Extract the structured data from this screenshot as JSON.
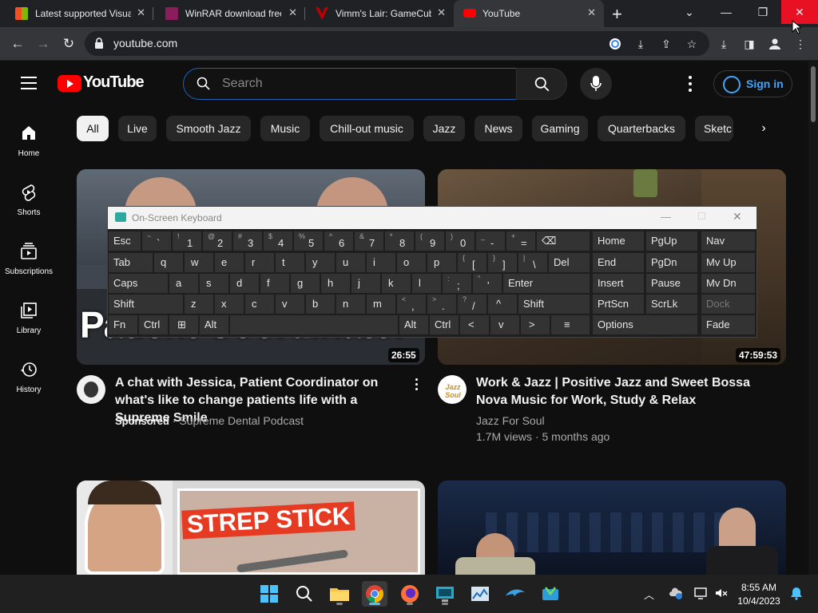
{
  "browser": {
    "tabs": [
      {
        "title": "Latest supported Visual",
        "favicon_color": "#0078d4"
      },
      {
        "title": "WinRAR download free",
        "favicon_color": "#8b1d5c"
      },
      {
        "title": "Vimm's Lair: GameCube",
        "favicon_color": "#c00000"
      },
      {
        "title": "YouTube",
        "favicon_color": "#ff0000",
        "active": true
      }
    ],
    "new_tab": "+",
    "url": "youtube.com"
  },
  "youtube": {
    "logo_text": "YouTube",
    "search_placeholder": "Search",
    "sign_in": "Sign in",
    "sidebar": [
      {
        "label": "Home",
        "icon": "home-icon"
      },
      {
        "label": "Shorts",
        "icon": "shorts-icon"
      },
      {
        "label": "Subscriptions",
        "icon": "subscriptions-icon"
      },
      {
        "label": "Library",
        "icon": "library-icon"
      },
      {
        "label": "History",
        "icon": "history-icon"
      }
    ],
    "chips": [
      "All",
      "Live",
      "Smooth Jazz",
      "Music",
      "Chill-out music",
      "Jazz",
      "News",
      "Gaming",
      "Quarterbacks",
      "Sketc"
    ],
    "videos": [
      {
        "title": "A chat with Jessica, Patient Coordinator on what's like to change patients life with a Supreme Smile",
        "sponsored": "Sponsored",
        "channel": "Supreme Dental Podcast",
        "duration": "26:55",
        "thumb_text": "Patient Coordinator"
      },
      {
        "title": "Work & Jazz | Positive Jazz and Sweet Bossa Nova Music for Work, Study & Relax",
        "channel": "Jazz For Soul",
        "views": "1.7M views",
        "age": "5 months ago",
        "duration": "47:59:53",
        "avatar_text": "Jazz Soul"
      },
      {
        "thumb_text": "STREP STICK"
      },
      {}
    ]
  },
  "osk": {
    "title": "On-Screen Keyboard",
    "rows": [
      [
        {
          "m": "Esc"
        },
        {
          "s": "~",
          "m": "`"
        },
        {
          "s": "!",
          "m": "1"
        },
        {
          "s": "@",
          "m": "2"
        },
        {
          "s": "#",
          "m": "3"
        },
        {
          "s": "$",
          "m": "4"
        },
        {
          "s": "%",
          "m": "5"
        },
        {
          "s": "^",
          "m": "6"
        },
        {
          "s": "&",
          "m": "7"
        },
        {
          "s": "*",
          "m": "8"
        },
        {
          "s": "(",
          "m": "9"
        },
        {
          "s": ")",
          "m": "0"
        },
        {
          "s": "_",
          "m": "-"
        },
        {
          "s": "+",
          "m": "="
        },
        {
          "m": "⌫"
        }
      ],
      [
        {
          "m": "Tab"
        },
        {
          "m": "q"
        },
        {
          "m": "w"
        },
        {
          "m": "e"
        },
        {
          "m": "r"
        },
        {
          "m": "t"
        },
        {
          "m": "y"
        },
        {
          "m": "u"
        },
        {
          "m": "i"
        },
        {
          "m": "o"
        },
        {
          "m": "p"
        },
        {
          "s": "{",
          "m": "["
        },
        {
          "s": "}",
          "m": "]"
        },
        {
          "s": "|",
          "m": "\\"
        },
        {
          "m": "Del"
        }
      ],
      [
        {
          "m": "Caps"
        },
        {
          "m": "a"
        },
        {
          "m": "s"
        },
        {
          "m": "d"
        },
        {
          "m": "f"
        },
        {
          "m": "g"
        },
        {
          "m": "h"
        },
        {
          "m": "j"
        },
        {
          "m": "k"
        },
        {
          "m": "l"
        },
        {
          "s": ":",
          "m": ";"
        },
        {
          "s": "\"",
          "m": "'"
        },
        {
          "m": "Enter"
        }
      ],
      [
        {
          "m": "Shift"
        },
        {
          "m": "z"
        },
        {
          "m": "x"
        },
        {
          "m": "c"
        },
        {
          "m": "v"
        },
        {
          "m": "b"
        },
        {
          "m": "n"
        },
        {
          "m": "m"
        },
        {
          "s": "<",
          "m": ","
        },
        {
          "s": ">",
          "m": "."
        },
        {
          "s": "?",
          "m": "/"
        },
        {
          "m": "^"
        },
        {
          "m": "Shift"
        }
      ],
      [
        {
          "m": "Fn"
        },
        {
          "m": "Ctrl"
        },
        {
          "m": "⊞"
        },
        {
          "m": "Alt"
        },
        {
          "m": ""
        },
        {
          "m": "Alt"
        },
        {
          "m": "Ctrl"
        },
        {
          "m": "<"
        },
        {
          "m": "v"
        },
        {
          "m": ">"
        },
        {
          "m": "≡"
        }
      ]
    ],
    "nav_rows": [
      [
        "Home",
        "PgUp",
        "Nav"
      ],
      [
        "End",
        "PgDn",
        "Mv Up"
      ],
      [
        "Insert",
        "Pause",
        "Mv Dn"
      ],
      [
        "PrtScn",
        "ScrLk",
        "Dock"
      ],
      [
        "Options",
        "Fade"
      ]
    ]
  },
  "taskbar": {
    "time": "8:55 AM",
    "date": "10/4/2023"
  }
}
